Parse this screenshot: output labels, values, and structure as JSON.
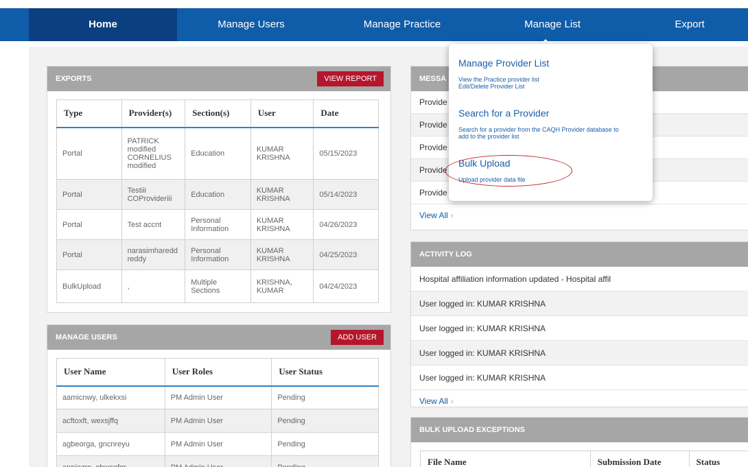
{
  "nav": {
    "home": "Home",
    "manage_users": "Manage Users",
    "manage_practice": "Manage Practice",
    "manage_list": "Manage List",
    "export": "Export"
  },
  "exports": {
    "title": "EXPORTS",
    "button": "VIEW REPORT",
    "headers": [
      "Type",
      "Provider(s)",
      "Section(s)",
      "User",
      "Date"
    ],
    "rows": [
      {
        "type": "Portal",
        "provider": "PATRICK modified CORNELIUS modified",
        "section": "Education",
        "user": "KUMAR KRISHNA",
        "date": "05/15/2023"
      },
      {
        "type": "Portal",
        "provider": "Testiii COProvideriii",
        "section": "Education",
        "user": "KUMAR KRISHNA",
        "date": "05/14/2023"
      },
      {
        "type": "Portal",
        "provider": "Test accnt",
        "section": "Personal Information",
        "user": "KUMAR KRISHNA",
        "date": "04/26/2023"
      },
      {
        "type": "Portal",
        "provider": "narasimharedd reddy",
        "section": "Personal Information",
        "user": "KUMAR KRISHNA",
        "date": "04/25/2023"
      },
      {
        "type": "BulkUpload",
        "provider": ",",
        "section": "Multiple Sections",
        "user": "KRISHNA, KUMAR",
        "date": "04/24/2023"
      }
    ]
  },
  "manage_users": {
    "title": "MANAGE USERS",
    "button": "ADD USER",
    "headers": [
      "User Name",
      "User Roles",
      "User Status"
    ],
    "rows": [
      {
        "name": "aamicnwy, ulkekxsi",
        "role": "PM Admin User",
        "status": "Pending"
      },
      {
        "name": "acftoxft, wexsjffq",
        "role": "PM Admin User",
        "status": "Pending"
      },
      {
        "name": "agbeorga, gncnreyu",
        "role": "PM Admin User",
        "status": "Pending"
      },
      {
        "name": "anpiozrp, gbwsofqr",
        "role": "PM Admin User",
        "status": "Pending"
      }
    ]
  },
  "messages": {
    "title": "MESSA",
    "rows": [
      "Provide",
      "Provide",
      "Provide",
      "Provide",
      "Provide"
    ],
    "view_all": "View All"
  },
  "activity": {
    "title": "ACTIVITY LOG",
    "rows": [
      "Hospital affiliation information updated - Hospital affil",
      "User logged in: KUMAR KRISHNA",
      "User logged in: KUMAR KRISHNA",
      "User logged in: KUMAR KRISHNA",
      "User logged in: KUMAR KRISHNA"
    ],
    "view_all": "View All"
  },
  "bulk": {
    "title": "BULK UPLOAD EXCEPTIONS",
    "headers": [
      "File Name",
      "Submission Date",
      "Status"
    ]
  },
  "dropdown": {
    "items": [
      {
        "title": "Manage Provider List",
        "desc": "View the Practice provider list\nEdit/Delete Provider List"
      },
      {
        "title": "Search for a Provider",
        "desc": "Search for a provider from the CAQH Provider database to add to the provider list"
      },
      {
        "title": "Bulk Upload",
        "desc": "Upload provider data file"
      }
    ]
  },
  "colors": {
    "nav": "#0f5ca9",
    "nav_active": "#0b3f7f",
    "button": "#b5162b",
    "accent_line": "#2a82c9",
    "annotation": "#c0262d"
  }
}
